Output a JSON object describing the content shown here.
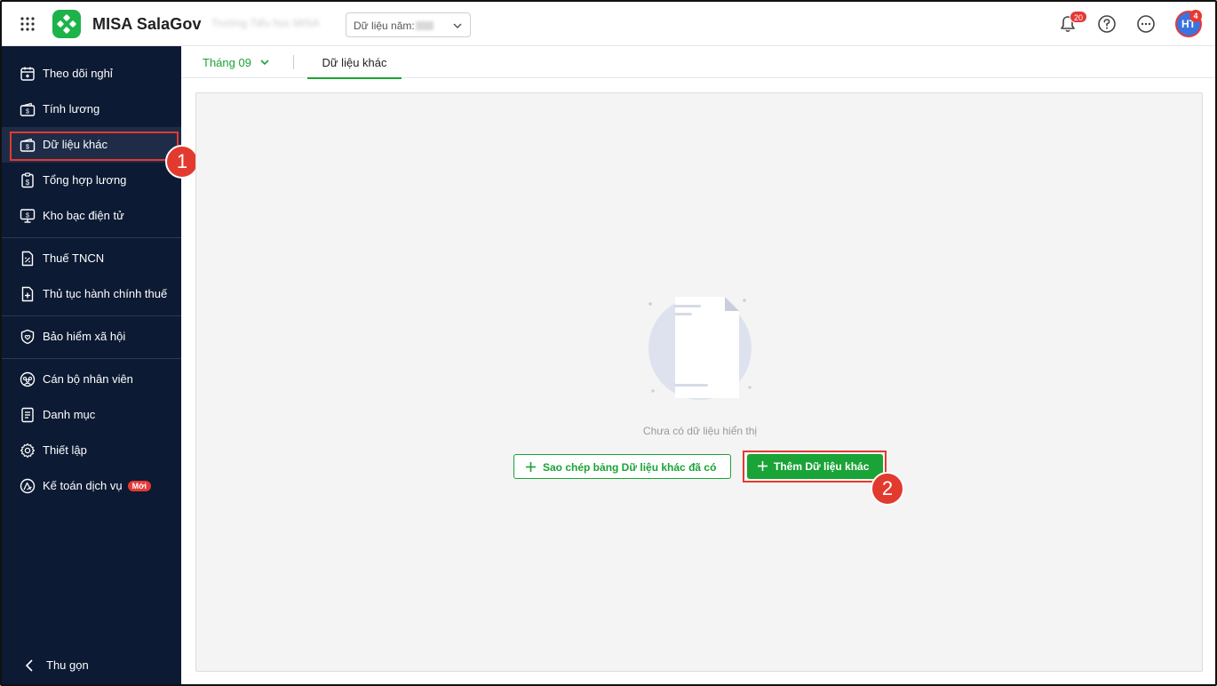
{
  "header": {
    "app_title": "MISA SalaGov",
    "org_name": "Trường Tiểu học MISA",
    "year_label": "Dữ liệu năm:",
    "notification_count": "20",
    "avatar_initials": "HT",
    "avatar_badge": "4",
    "accent_color": "#1db34a"
  },
  "sidebar": {
    "items": [
      {
        "label": "Theo dõi nghỉ",
        "icon": "calendar-icon"
      },
      {
        "label": "Tính lương",
        "icon": "wallet-icon"
      },
      {
        "label": "Dữ liệu khác",
        "icon": "wallet-icon",
        "active": true
      },
      {
        "label": "Tổng hợp lương",
        "icon": "clipboard-icon"
      },
      {
        "label": "Kho bạc điện tử",
        "icon": "monitor-icon"
      },
      {
        "label": "Thuế TNCN",
        "icon": "document-percent-icon"
      },
      {
        "label": "Thủ tục hành chính thuế",
        "icon": "document-plus-icon"
      },
      {
        "label": "Bảo hiểm xã hội",
        "icon": "shield-heart-icon"
      },
      {
        "label": "Cán bộ nhân viên",
        "icon": "people-icon"
      },
      {
        "label": "Danh mục",
        "icon": "list-document-icon"
      },
      {
        "label": "Thiết lập",
        "icon": "gear-icon"
      },
      {
        "label": "Kế toán dịch vụ",
        "icon": "service-icon",
        "badge": "Mới"
      }
    ],
    "collapse_label": "Thu gọn"
  },
  "tabs": {
    "month": "Tháng 09",
    "active_tab": "Dữ liệu khác"
  },
  "empty_state": {
    "message": "Chưa có dữ liệu hiển thị",
    "copy_button": "Sao chép bảng Dữ liệu khác đã có",
    "add_button": "Thêm Dữ liệu khác"
  },
  "annotations": {
    "step1": "1",
    "step2": "2"
  }
}
